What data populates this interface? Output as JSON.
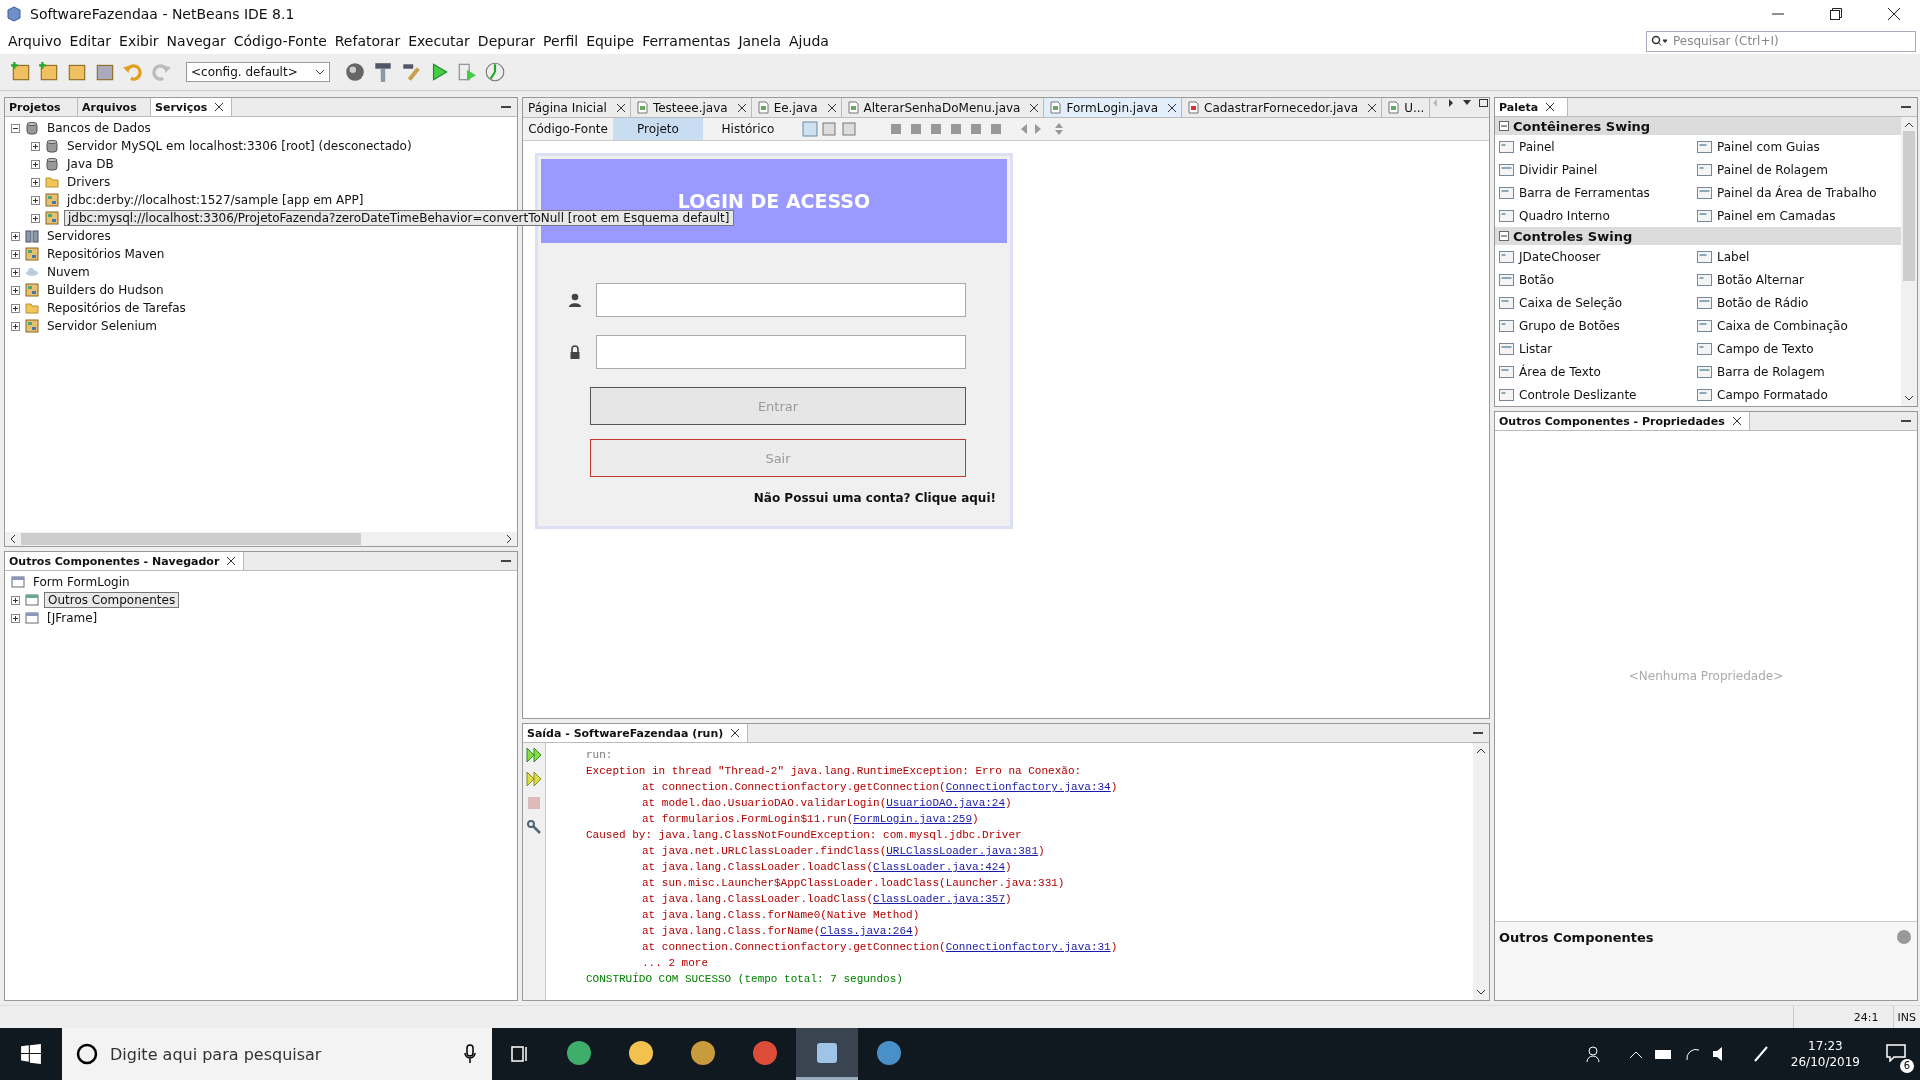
{
  "window": {
    "title": "SoftwareFazendaa - NetBeans IDE 8.1"
  },
  "menu": [
    "Arquivo",
    "Editar",
    "Exibir",
    "Navegar",
    "Código-Fonte",
    "Refatorar",
    "Executar",
    "Depurar",
    "Perfil",
    "Equipe",
    "Ferramentas",
    "Janela",
    "Ajuda"
  ],
  "search": {
    "placeholder": "Pesquisar (Ctrl+I)"
  },
  "toolbar": {
    "config_select": "<config. default>"
  },
  "left_tabs": [
    {
      "label": "Projetos",
      "selected": false
    },
    {
      "label": "Arquivos",
      "selected": false
    },
    {
      "label": "Serviços",
      "selected": true
    }
  ],
  "services_tree": [
    {
      "label": "Bancos de Dados",
      "expanded": true,
      "selected": false,
      "children": [
        {
          "label": "Servidor MySQL em localhost:3306 [root] (desconectado)",
          "expanded": false,
          "selected": false
        },
        {
          "label": "Java DB",
          "expanded": false,
          "selected": false
        },
        {
          "label": "Drivers",
          "expanded": false,
          "selected": false
        },
        {
          "label": "jdbc:derby://localhost:1527/sample [app em APP]",
          "expanded": false,
          "selected": false
        },
        {
          "label": "jdbc:mysql://localhost:3306/ProjetoFazenda?zeroDateTimeBehavior=convertToNull [root em Esquema default]",
          "expanded": false,
          "selected": true
        }
      ]
    },
    {
      "label": "Servidores",
      "expanded": false,
      "selected": false
    },
    {
      "label": "Repositórios Maven",
      "expanded": false,
      "selected": false
    },
    {
      "label": "Nuvem",
      "expanded": false,
      "selected": false
    },
    {
      "label": "Builders do Hudson",
      "expanded": false,
      "selected": false
    },
    {
      "label": "Repositórios de Tarefas",
      "expanded": false,
      "selected": false
    },
    {
      "label": "Servidor Selenium",
      "expanded": false,
      "selected": false
    }
  ],
  "navigator": {
    "title": "Outros Componentes - Navegador",
    "tree": [
      {
        "label": "Form FormLogin",
        "selected": false,
        "children": [
          {
            "label": "Outros Componentes",
            "expanded": false,
            "selected": true
          },
          {
            "label": "[JFrame]",
            "expanded": false,
            "selected": false
          }
        ]
      }
    ]
  },
  "editor_tabs": [
    {
      "label": "Página Inicial",
      "selected": false
    },
    {
      "label": "Testeee.java",
      "selected": false
    },
    {
      "label": "Ee.java",
      "selected": false
    },
    {
      "label": "AlterarSenhaDoMenu.java",
      "selected": false
    },
    {
      "label": "FormLogin.java",
      "selected": true
    },
    {
      "label": "CadastrarFornecedor.java",
      "selected": false
    },
    {
      "label": "U...",
      "selected": false
    }
  ],
  "view_tabs": [
    {
      "label": "Código-Fonte",
      "selected": false
    },
    {
      "label": "Projeto",
      "selected": true
    },
    {
      "label": "Histórico",
      "selected": false
    }
  ],
  "form": {
    "header": "LOGIN DE ACESSO",
    "buttons": [
      {
        "label": "Entrar",
        "kind": "primary",
        "disabled": true
      },
      {
        "label": "Sair",
        "kind": "danger",
        "disabled": true
      }
    ],
    "signup_text": "Não Possui uma conta? Clique aqui!"
  },
  "palette": {
    "title": "Paleta",
    "sections": [
      {
        "title": "Contêineres Swing",
        "expanded": true,
        "items": [
          "Painel",
          "Painel com Guias",
          "Dividir Painel",
          "Painel de Rolagem",
          "Barra de Ferramentas",
          "Painel da Área de Trabalho",
          "Quadro Interno",
          "Painel em Camadas"
        ]
      },
      {
        "title": "Controles Swing",
        "expanded": true,
        "items": [
          "JDateChooser",
          "Label",
          "Botão",
          "Botão Alternar",
          "Caixa de Seleção",
          "Botão de Rádio",
          "Grupo de Botões",
          "Caixa de Combinação",
          "Listar",
          "Campo de Texto",
          "Área de Texto",
          "Barra de Rolagem",
          "Controle Deslizante",
          "Campo Formatado"
        ]
      }
    ]
  },
  "properties": {
    "title": "Outros Componentes - Propriedades",
    "empty_text": "<Nenhuma Propriedade>",
    "footer": "Outros Componentes"
  },
  "output": {
    "title": "Saída - SoftwareFazendaa (run)",
    "lines": [
      {
        "kind": "plain",
        "parts": [
          {
            "text": "run:"
          }
        ]
      },
      {
        "kind": "error",
        "parts": [
          {
            "text": "Exception in thread \"Thread-2\" java.lang.RuntimeException: Erro na Conexão:"
          }
        ]
      },
      {
        "kind": "frame",
        "parts": [
          {
            "text": "at connection.Connectionfactory.getConnection("
          },
          {
            "text": "Connectionfactory.java:34",
            "link": true
          },
          {
            "text": ")"
          }
        ]
      },
      {
        "kind": "frame",
        "parts": [
          {
            "text": "at model.dao.UsuarioDAO.validarLogin("
          },
          {
            "text": "UsuarioDAO.java:24",
            "link": true
          },
          {
            "text": ")"
          }
        ]
      },
      {
        "kind": "frame",
        "parts": [
          {
            "text": "at formularios.FormLogin$11.run("
          },
          {
            "text": "FormLogin.java:259",
            "link": true
          },
          {
            "text": ")"
          }
        ]
      },
      {
        "kind": "error",
        "parts": [
          {
            "text": "Caused by: java.lang.ClassNotFoundException: com.mysql.jdbc.Driver"
          }
        ]
      },
      {
        "kind": "frame",
        "parts": [
          {
            "text": "at java.net.URLClassLoader.findClass("
          },
          {
            "text": "URLClassLoader.java:381",
            "link": true
          },
          {
            "text": ")"
          }
        ]
      },
      {
        "kind": "frame",
        "parts": [
          {
            "text": "at java.lang.ClassLoader.loadClass("
          },
          {
            "text": "ClassLoader.java:424",
            "link": true
          },
          {
            "text": ")"
          }
        ]
      },
      {
        "kind": "frame",
        "parts": [
          {
            "text": "at sun.misc.Launcher$AppClassLoader.loadClass(Launcher.java:331)"
          }
        ]
      },
      {
        "kind": "frame",
        "parts": [
          {
            "text": "at java.lang.ClassLoader.loadClass("
          },
          {
            "text": "ClassLoader.java:357",
            "link": true
          },
          {
            "text": ")"
          }
        ]
      },
      {
        "kind": "frame",
        "parts": [
          {
            "text": "at java.lang.Class.forName0(Native Method)"
          }
        ]
      },
      {
        "kind": "frame",
        "parts": [
          {
            "text": "at java.lang.Class.forName("
          },
          {
            "text": "Class.java:264",
            "link": true
          },
          {
            "text": ")"
          }
        ]
      },
      {
        "kind": "frame",
        "parts": [
          {
            "text": "at connection.Connectionfactory.getConnection("
          },
          {
            "text": "Connectionfactory.java:31",
            "link": true
          },
          {
            "text": ")"
          }
        ]
      },
      {
        "kind": "frame",
        "parts": [
          {
            "text": "... 2 more"
          }
        ]
      },
      {
        "kind": "success",
        "parts": [
          {
            "text": "CONSTRUÍDO COM SUCESSO (tempo total: 7 segundos)"
          }
        ]
      }
    ]
  },
  "status_bar": {
    "position": "24:1",
    "mode": "INS"
  },
  "taskbar": {
    "search_placeholder": "Digite aqui para pesquisar",
    "apps": [
      {
        "selected": false
      },
      {
        "selected": false
      },
      {
        "selected": false
      },
      {
        "selected": false
      },
      {
        "selected": true
      },
      {
        "selected": false
      }
    ],
    "time": "17:23",
    "date": "26/10/2019",
    "notifications": "6"
  }
}
